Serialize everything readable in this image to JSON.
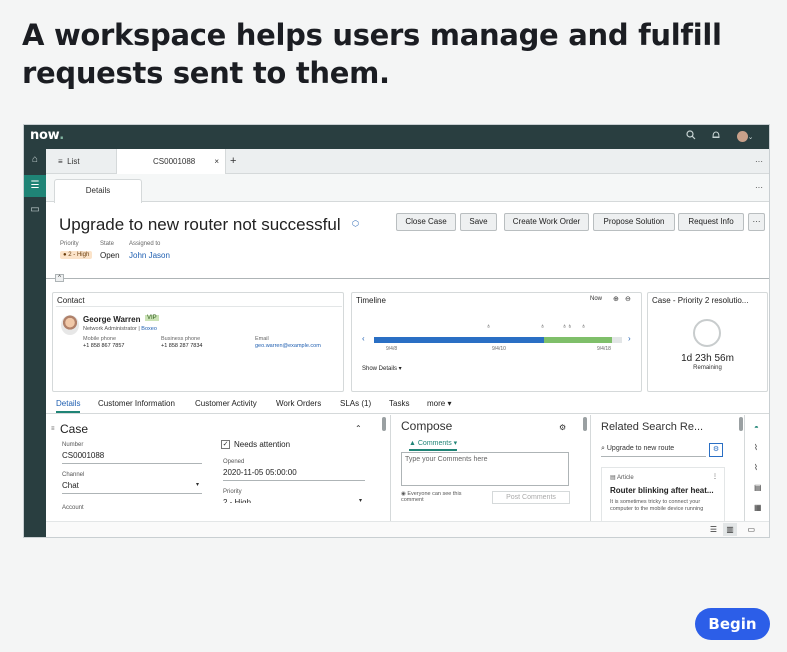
{
  "headline": "A workspace helps users manage and fulfill requests sent to them.",
  "app": {
    "logo_text": "now",
    "logo_dot": "."
  },
  "tabs": {
    "list_label": "List",
    "record_label": "CS0001088"
  },
  "subtab": "Details",
  "record": {
    "title": "Upgrade to new router not successful",
    "priority_label": "Priority",
    "priority_value": "2 - High",
    "state_label": "State",
    "state_value": "Open",
    "assigned_label": "Assigned to",
    "assigned_value": "John Jason"
  },
  "actions": [
    "Close Case",
    "Save",
    "Create Work Order",
    "Propose Solution",
    "Request Info"
  ],
  "contact": {
    "header": "Contact",
    "name": "George Warren",
    "vip": "VIP",
    "role": "Network Administrator",
    "company": "Boxeo",
    "mobile_label": "Mobile phone",
    "mobile_value": "+1 858 867 7857",
    "business_label": "Business phone",
    "business_value": "+1 858 287 7834",
    "email_label": "Email",
    "email_value": "geo.warren@example.com"
  },
  "timeline": {
    "header": "Timeline",
    "now": "Now",
    "date_start": "9/4/8",
    "date_mid": "9/4/10",
    "date_end": "9/4/18",
    "show_details": "Show Details"
  },
  "sla": {
    "header": "Case - Priority 2 resolutio...",
    "time": "1d 23h 56m",
    "remaining": "Remaining"
  },
  "record_tabs": [
    "Details",
    "Customer Information",
    "Customer Activity",
    "Work Orders",
    "SLAs (1)",
    "Tasks",
    "more"
  ],
  "case_form": {
    "section_title": "Case",
    "number_label": "Number",
    "number_value": "CS0001088",
    "channel_label": "Channel",
    "channel_value": "Chat",
    "account_label": "Account",
    "needs_attention": "Needs attention",
    "opened_label": "Opened",
    "opened_value": "2020-11-05 05:00:00",
    "priority_label": "Priority",
    "priority_value": "2 - High"
  },
  "compose": {
    "title": "Compose",
    "tab_label": "Comments",
    "placeholder": "Type your Comments here",
    "visibility_note": "Everyone can see this comment",
    "post_button": "Post Comments"
  },
  "related": {
    "title": "Related Search Re...",
    "search_value": "Upgrade to new route",
    "article_type": "Article",
    "article_title": "Router blinking after heat...",
    "article_snippet": "It is sometimes tricky to connect your computer to the mobile device running"
  },
  "begin_button": "Begin",
  "colors": {
    "nav": "#293e40",
    "accent": "#1f8476",
    "link": "#1f5fb1",
    "timeline_blue": "#2a6fc4",
    "timeline_green": "#7fbf6a",
    "begin": "#2c5ee8"
  }
}
